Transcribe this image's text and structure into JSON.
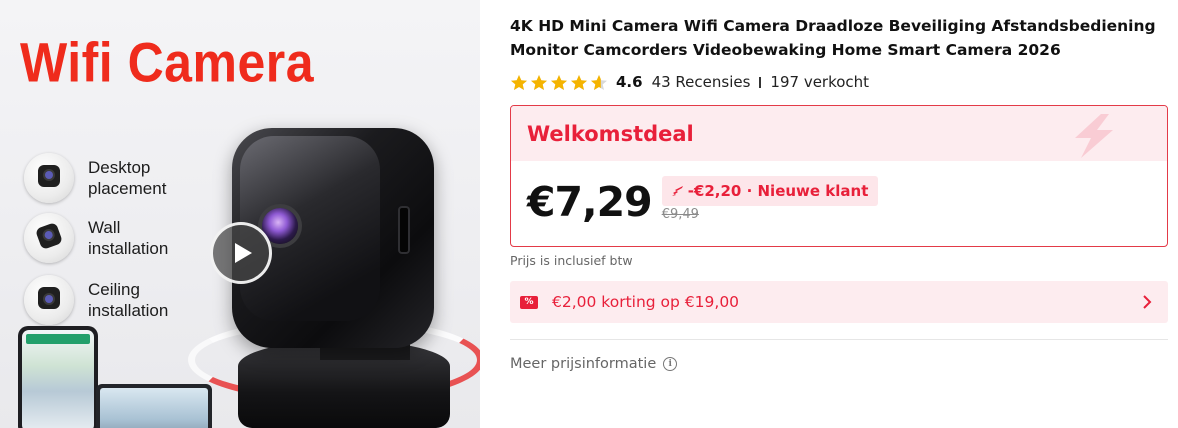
{
  "image": {
    "headline": "Wifi Camera",
    "features": [
      {
        "label": "Desktop\nplacement"
      },
      {
        "label": "Wall\ninstallation"
      },
      {
        "label": "Ceiling\ninstallation"
      }
    ],
    "play_icon": "play-icon"
  },
  "product": {
    "title": "4K HD Mini Camera Wifi Camera Draadloze Beveiliging Afstandsbediening Monitor Camcorders Videobewaking Home Smart Camera 2026",
    "rating": 4.6,
    "rating_text": "4.6",
    "stars_filled": 4.6,
    "reviews_text": "43 Recensies",
    "sold_text": "197 verkocht"
  },
  "deal": {
    "title": "Welkomstdeal",
    "current_price": "€7,29",
    "discount_text": "-€2,20 · Nieuwe klant",
    "original_price": "€9,49"
  },
  "vat_note": "Prijs is inclusief btw",
  "coupon": {
    "icon_text": "%",
    "text": "€2,00 korting op €19,00"
  },
  "more_info": "Meer prijsinformatie",
  "colors": {
    "accent_red": "#e8203a",
    "star_yellow": "#f5b400",
    "deal_bg": "#fdecef",
    "headline_red": "#ef2b1c"
  }
}
